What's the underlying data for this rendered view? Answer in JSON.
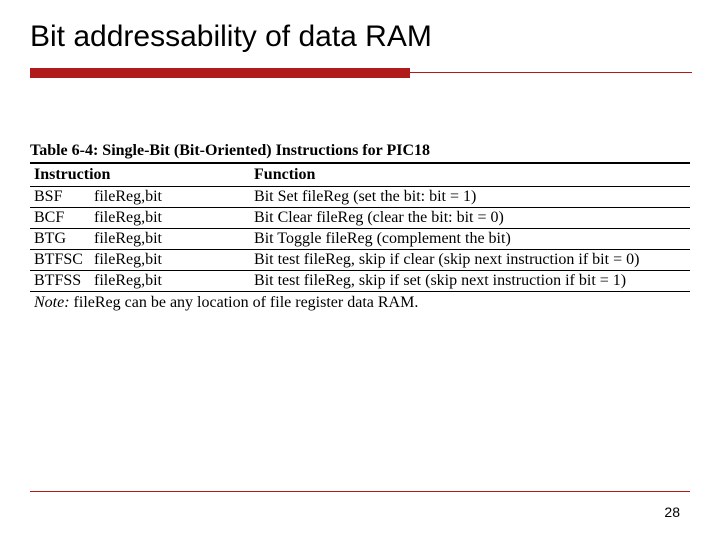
{
  "slide": {
    "title": "Bit addressability of data RAM",
    "page_number": "28"
  },
  "table": {
    "caption": "Table 6-4: Single-Bit (Bit-Oriented) Instructions for PIC18",
    "headers": {
      "instruction": "Instruction",
      "function": "Function"
    },
    "rows": [
      {
        "mnemonic": "BSF",
        "args": "fileReg,bit",
        "function": "Bit Set fileReg (set the bit: bit = 1)"
      },
      {
        "mnemonic": "BCF",
        "args": "fileReg,bit",
        "function": "Bit Clear fileReg (clear the bit: bit = 0)"
      },
      {
        "mnemonic": "BTG",
        "args": "fileReg,bit",
        "function": "Bit Toggle fileReg (complement the bit)"
      },
      {
        "mnemonic": "BTFSC",
        "args": "fileReg,bit",
        "function": "Bit test fileReg, skip if clear (skip next instruction if bit = 0)"
      },
      {
        "mnemonic": "BTFSS",
        "args": "fileReg,bit",
        "function": "Bit test fileReg, skip if set (skip next instruction if bit = 1)"
      }
    ],
    "note_label": "Note:",
    "note_text": " fileReg can be any location of file register data RAM."
  }
}
